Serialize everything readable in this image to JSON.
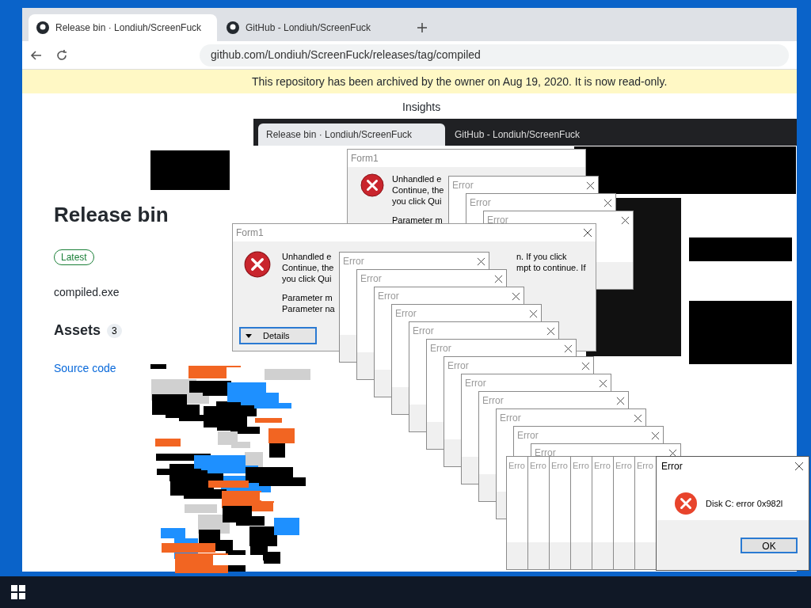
{
  "browser": {
    "tabs": [
      {
        "title": "Release bin · Londiuh/ScreenFuck",
        "selected": true
      },
      {
        "title": "GitHub - Londiuh/ScreenFuck",
        "selected": false
      }
    ],
    "address": "github.com/Londiuh/ScreenFuck/releases/tag/compiled",
    "banner": "This repository has been archived by the owner on Aug 19, 2020. It is now read-only.",
    "nav": [
      "Insights"
    ],
    "release": {
      "title": "Release bin",
      "badge": "Latest",
      "asset": "compiled.exe",
      "assets_heading": "Assets",
      "assets_count": "3",
      "source": "Source code"
    }
  },
  "back_browser": {
    "tabs": [
      {
        "title": "Release bin · Londiuh/ScreenFuck",
        "selected": true
      },
      {
        "title": "GitHub - Londiuh/ScreenFuck",
        "selected": false
      }
    ]
  },
  "back_form": {
    "title": "Form1",
    "paragraphs": [
      [
        "Unhandled e",
        "Continue, the",
        "you click Qui"
      ],
      [
        "Parameter m"
      ]
    ]
  },
  "back_errors": [
    {
      "title": "Error"
    },
    {
      "title": "Error"
    },
    {
      "title": "Error"
    }
  ],
  "front_form": {
    "title": "Form1",
    "paragraphs": [
      [
        "Unhandled e",
        "Continue, the",
        "you click Qui"
      ],
      [
        "Parameter m",
        "Parameter na"
      ]
    ],
    "right_lines": [
      "n. If you click",
      "mpt to continue. If"
    ],
    "button": "Details"
  },
  "error_cascade": [
    {
      "title": "Error"
    },
    {
      "title": "Error"
    },
    {
      "title": "Error"
    },
    {
      "title": "Error"
    },
    {
      "title": "Error"
    },
    {
      "title": "Error"
    },
    {
      "title": "Error"
    },
    {
      "title": "Error"
    },
    {
      "title": "Error"
    },
    {
      "title": "Error"
    },
    {
      "title": "Error"
    },
    {
      "title": "Error"
    }
  ],
  "error_strips": [
    {
      "title": "Erro"
    },
    {
      "title": "Erro"
    },
    {
      "title": "Erro"
    },
    {
      "title": "Erro"
    },
    {
      "title": "Erro"
    },
    {
      "title": "Erro"
    },
    {
      "title": "Erro"
    }
  ],
  "final_error": {
    "title": "Error",
    "message": "Disk C: error 0x982l",
    "button": "OK"
  }
}
